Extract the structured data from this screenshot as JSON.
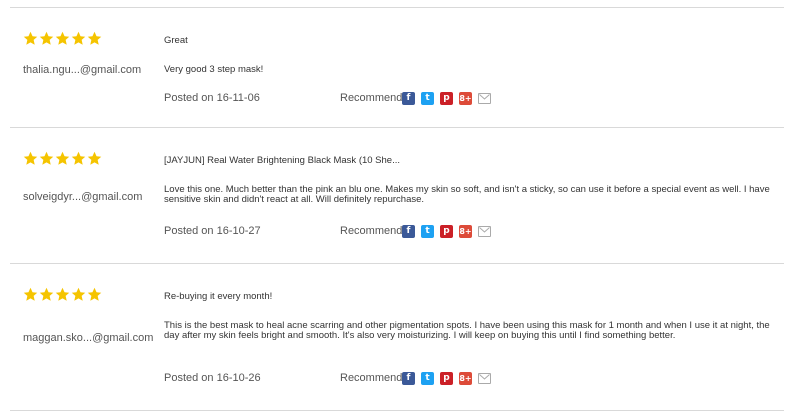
{
  "reviews": [
    {
      "rating": 5,
      "email": "thalia.ngu...@gmail.com",
      "title": "Great",
      "body": "Very good 3 step mask!",
      "posted": "Posted on 16-11-06",
      "recommend_label": "Recommend"
    },
    {
      "rating": 5,
      "email": "solveigdyr...@gmail.com",
      "title": "[JAYJUN] Real Water Brightening Black Mask (10 She...",
      "body": "Love this one. Much better than the pink an blu one. Makes my skin so soft, and isn't a sticky, so can use it before a special event as well. I have sensitive skin and didn't react at all.  Will definitely repurchase.",
      "posted": "Posted on 16-10-27",
      "recommend_label": "Recommend"
    },
    {
      "rating": 5,
      "email": "maggan.sko...@gmail.com",
      "title": "Re-buying it every month!",
      "body": "This is the best mask to heal acne scarring and other pigmentation spots. I have been using this mask for 1 month and when I use it at night, the day after my skin feels bright and smooth. It's also very moisturizing. I will keep on buying this until I find something better.",
      "posted": "Posted on 16-10-26",
      "recommend_label": "Recommend"
    }
  ],
  "share_icons": [
    "facebook-icon",
    "twitter-icon",
    "pinterest-icon",
    "google-plus-icon",
    "mail-icon"
  ],
  "share_glyphs": {
    "facebook": "f",
    "twitter": "t",
    "pinterest": "p",
    "google_plus": "8+"
  },
  "colors": {
    "star": "#f5c400",
    "facebook": "#3b5998",
    "twitter": "#1da1f2",
    "pinterest": "#cb2027",
    "google_plus": "#dd4b39",
    "divider": "#d9d9d9"
  }
}
